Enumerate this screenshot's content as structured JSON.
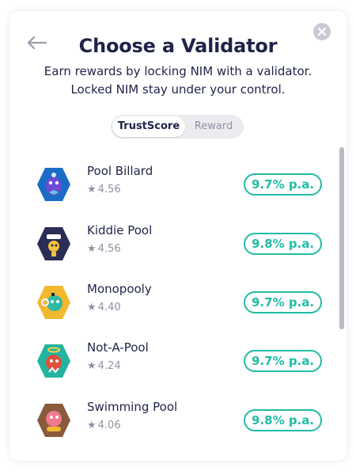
{
  "header": {
    "title": "Choose a Validator",
    "subtitle_line1": "Earn rewards by locking NIM with a validator.",
    "subtitle_line2": "Locked NIM stay under your control.",
    "back_icon": "arrow-left-icon",
    "close_icon": "close-icon"
  },
  "sort_toggle": {
    "options": [
      "TrustScore",
      "Reward"
    ],
    "selected": "TrustScore"
  },
  "colors": {
    "text": "#1f2348",
    "muted": "#8f91a3",
    "accent_green": "#21bca5"
  },
  "validators": [
    {
      "name": "Pool Billard",
      "score": "4.56",
      "reward": "9.7% p.a.",
      "avatar_color": "#1b6cc4"
    },
    {
      "name": "Kiddie Pool",
      "score": "4.56",
      "reward": "9.8% p.a.",
      "avatar_color": "#2a2d54"
    },
    {
      "name": "Monopooly",
      "score": "4.40",
      "reward": "9.7% p.a.",
      "avatar_color": "#f2b92f"
    },
    {
      "name": "Not-A-Pool",
      "score": "4.24",
      "reward": "9.7% p.a.",
      "avatar_color": "#23b3a0"
    },
    {
      "name": "Swimming Pool",
      "score": "4.06",
      "reward": "9.8% p.a.",
      "avatar_color": "#8a5a3c"
    }
  ]
}
